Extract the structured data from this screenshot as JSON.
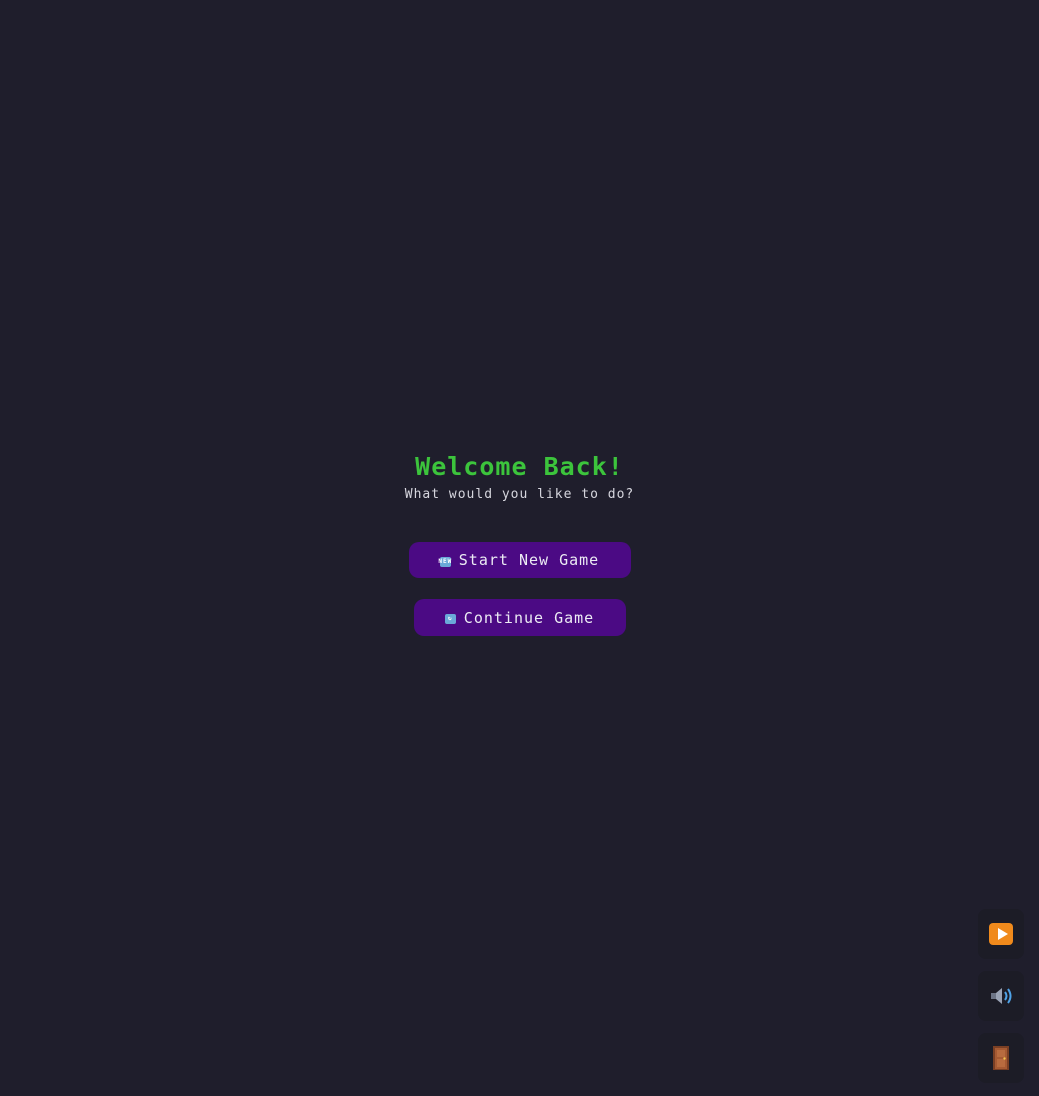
{
  "menu": {
    "title": "Welcome Back!",
    "subtitle": "What would you like to do?",
    "new_game": {
      "icon": "new-icon",
      "icon_text": "NEW",
      "label": "Start New Game"
    },
    "continue_game": {
      "icon": "refresh-icon",
      "icon_text": "↻",
      "label": "Continue Game"
    }
  },
  "controls": [
    {
      "name": "play-button",
      "icon": "play-icon"
    },
    {
      "name": "sound-button",
      "icon": "speaker-icon"
    },
    {
      "name": "exit-button",
      "icon": "door-icon"
    }
  ],
  "colors": {
    "background": "#1f1e2c",
    "title": "#3cc43c",
    "button": "#4b0a84",
    "control_bg": "#1c1c26"
  }
}
